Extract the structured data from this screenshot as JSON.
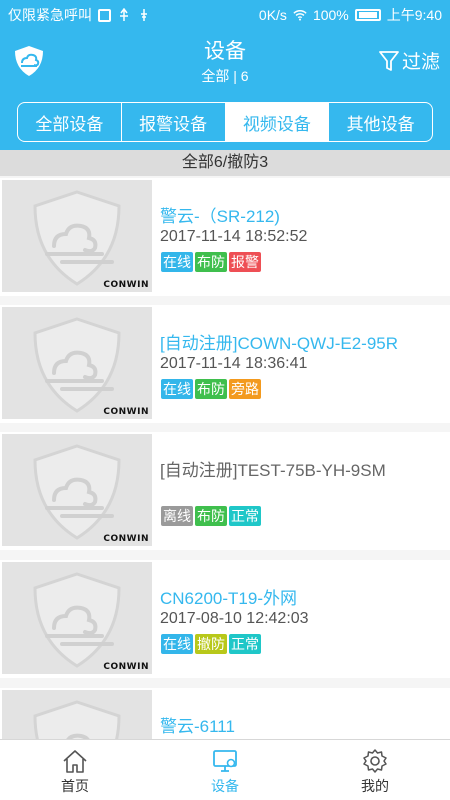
{
  "status_bar": {
    "left_text": "仅限紧急呼叫",
    "speed": "0K/s",
    "battery": "100%",
    "time": "上午9:40"
  },
  "header": {
    "title": "设备",
    "subtitle": "全部 | 6",
    "filter_label": "过滤",
    "logo_icon": "shield-cloud-logo",
    "filter_icon": "funnel-icon"
  },
  "tabs": [
    {
      "label": "全部设备",
      "active": false
    },
    {
      "label": "报警设备",
      "active": false
    },
    {
      "label": "视频设备",
      "active": true
    },
    {
      "label": "其他设备",
      "active": false
    }
  ],
  "summary": "全部6/撤防3",
  "thumbnail_brand": "CONWIN",
  "devices": [
    {
      "name": "警云-（SR-212)",
      "time": "2017-11-14 18:52:52",
      "online": true,
      "badges": [
        {
          "text": "在线",
          "color": "#33b6ea"
        },
        {
          "text": "布防",
          "color": "#3fbf4d"
        },
        {
          "text": "报警",
          "color": "#ee4f55"
        }
      ]
    },
    {
      "name": "[自动注册]COWN-QWJ-E2-95R",
      "time": "2017-11-14 18:36:41",
      "online": true,
      "badges": [
        {
          "text": "在线",
          "color": "#33b6ea"
        },
        {
          "text": "布防",
          "color": "#3fbf4d"
        },
        {
          "text": "旁路",
          "color": "#f39a1e"
        }
      ]
    },
    {
      "name": "[自动注册]TEST-75B-YH-9SM",
      "time": "",
      "online": false,
      "badges": [
        {
          "text": "离线",
          "color": "#9a9a9a"
        },
        {
          "text": "布防",
          "color": "#3fbf4d"
        },
        {
          "text": "正常",
          "color": "#1fc7c8"
        }
      ]
    },
    {
      "name": "CN6200-T19-外网",
      "time": "2017-08-10 12:42:03",
      "online": true,
      "badges": [
        {
          "text": "在线",
          "color": "#33b6ea"
        },
        {
          "text": "撤防",
          "color": "#b8c81a"
        },
        {
          "text": "正常",
          "color": "#1fc7c8"
        }
      ]
    },
    {
      "name": "警云-6111",
      "time": "",
      "online": true,
      "badges": []
    }
  ],
  "bottom_nav": [
    {
      "label": "首页",
      "icon": "home-icon",
      "active": false
    },
    {
      "label": "设备",
      "icon": "device-monitor-icon",
      "active": true
    },
    {
      "label": "我的",
      "icon": "gear-icon",
      "active": false
    }
  ],
  "colors": {
    "primary": "#35b8ee",
    "summary_bg": "#dcdcdc"
  }
}
